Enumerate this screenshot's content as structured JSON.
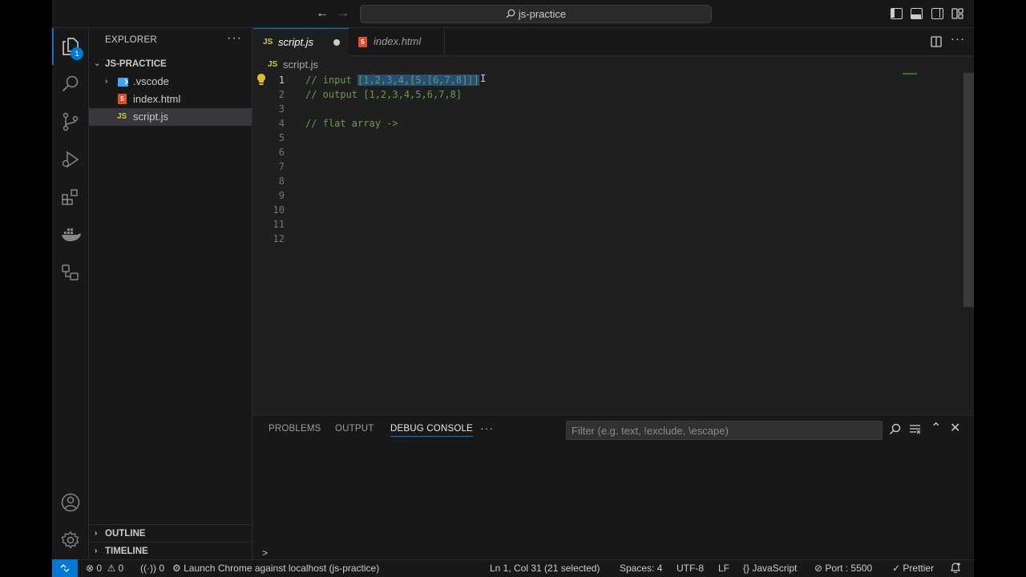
{
  "titlebar": {
    "search_text": "js-practice"
  },
  "activity": {
    "explorer_badge": "1"
  },
  "sidebar": {
    "title": "EXPLORER",
    "project": "JS-PRACTICE",
    "items": [
      {
        "label": ".vscode",
        "type": "folder"
      },
      {
        "label": "index.html",
        "type": "html"
      },
      {
        "label": "script.js",
        "type": "js"
      }
    ],
    "outline": "OUTLINE",
    "timeline": "TIMELINE"
  },
  "tabs": [
    {
      "icon": "JS",
      "label": "script.js",
      "modified": true
    },
    {
      "icon": "5",
      "label": "index.html",
      "modified": false
    }
  ],
  "breadcrumb": {
    "icon": "JS",
    "file": "script.js"
  },
  "editor": {
    "line_numbers": [
      "1",
      "2",
      "3",
      "4",
      "5",
      "6",
      "7",
      "8",
      "9",
      "10",
      "11",
      "12"
    ],
    "line1_prefix": "// input ",
    "line1_selected": "[1,2,3,4,[5,[6,7,8]]]",
    "line2": "// output [1,2,3,4,5,6,7,8]",
    "line4": "// flat array ->"
  },
  "panel": {
    "tabs": [
      "PROBLEMS",
      "OUTPUT",
      "DEBUG CONSOLE"
    ],
    "filter_placeholder": "Filter (e.g. text, !exclude, \\escape)",
    "prompt": ">"
  },
  "statusbar": {
    "errors": "0",
    "warnings": "0",
    "ports": "0",
    "launch": "Launch Chrome against localhost (js-practice)",
    "position": "Ln 1, Col 31 (21 selected)",
    "spaces": "Spaces: 4",
    "encoding": "UTF-8",
    "eol": "LF",
    "language": "JavaScript",
    "port": "Port : 5500",
    "prettier": "Prettier"
  },
  "colors": {
    "accent": "#0078d4",
    "comment": "#6a9955",
    "selection": "#264f78",
    "js_icon": "#cbcb41",
    "html_icon": "#e44d26"
  }
}
